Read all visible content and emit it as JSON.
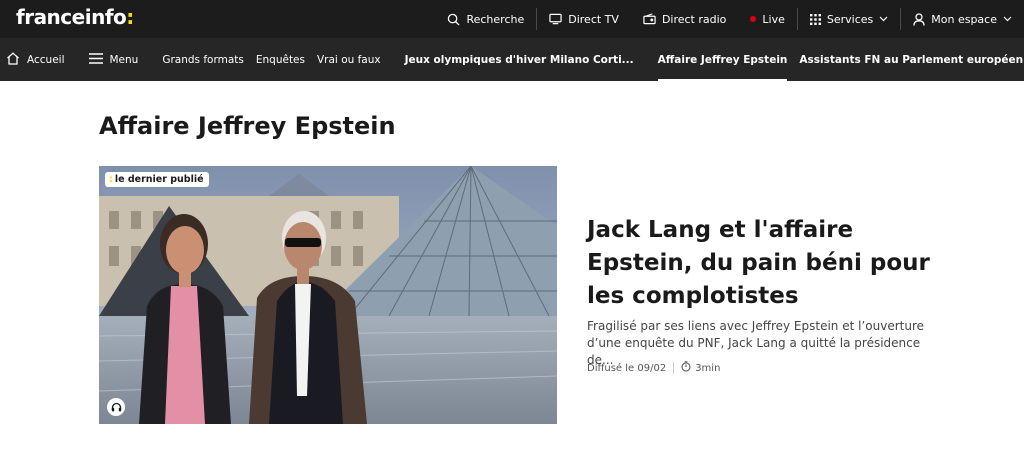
{
  "header": {
    "logo_text": "franceinfo",
    "logo_colon": ":",
    "search_label": "Recherche",
    "direct_tv_label": "Direct TV",
    "direct_radio_label": "Direct radio",
    "live_label": "Live",
    "services_label": "Services",
    "account_label": "Mon espace"
  },
  "nav": {
    "home_label": "Accueil",
    "menu_label": "Menu",
    "links": [
      "Grands formats",
      "Enquêtes",
      "Vrai ou faux"
    ],
    "topics": [
      "Jeux olympiques d'hiver Milano Corti...",
      "Affaire Jeffrey Epstein",
      "Assistants FN au Parlement européen"
    ],
    "active_topic": "Affaire Jeffrey Epstein"
  },
  "page": {
    "title": "Affaire Jeffrey Epstein"
  },
  "featured": {
    "badge_mark": ":",
    "badge_label": "le dernier publié",
    "headline": "Jack Lang et l'affaire Epstein, du pain béni pour les complotistes",
    "description": "Fragilisé par ses liens avec Jeffrey Epstein et l’ouverture d’une enquête du PNF, Jack Lang a quitté la présidence de...",
    "published": "Diffusé le 09/02",
    "duration": "3min"
  },
  "colors": {
    "brand_yellow": "#fed41d",
    "live_red": "#e1000f",
    "topbar_bg": "#1c1c1c",
    "navbar_bg": "#262626"
  }
}
